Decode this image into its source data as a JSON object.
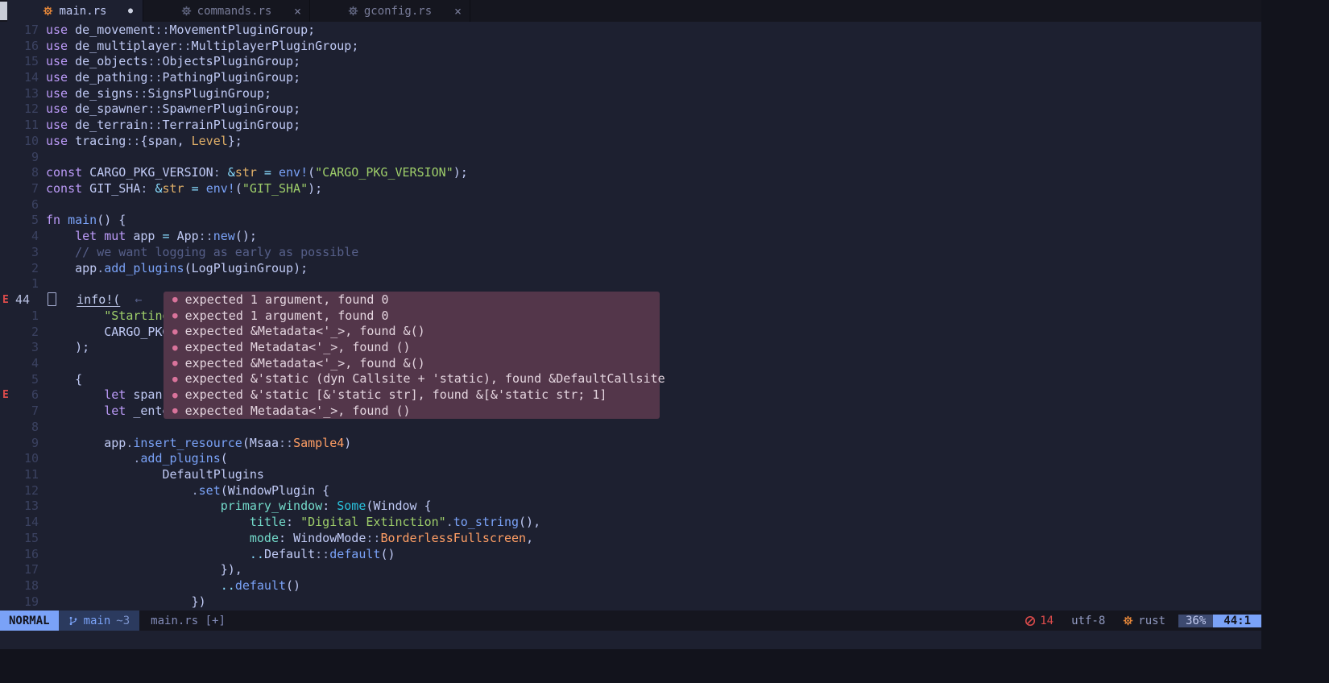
{
  "colors": {
    "accent": "#7aa2f7",
    "error": "#db4b4b",
    "editor_bg": "#1d2030",
    "tabline_bg": "#15161f",
    "popup_bg": "#53364a",
    "popup_bullet": "#d9739b",
    "rust_icon": "#e8883a",
    "keyword": "#bb9af7",
    "string": "#9ece6a"
  },
  "tabs": [
    {
      "label": "main.rs",
      "active": true,
      "modified": true,
      "close": false
    },
    {
      "label": "commands.rs",
      "active": false,
      "modified": false,
      "close": true
    },
    {
      "label": "gconfig.rs",
      "active": false,
      "modified": false,
      "close": true
    }
  ],
  "tab_close_glyph": "×",
  "tab_modified_glyph": "●",
  "editor": {
    "lines": [
      {
        "sign": "",
        "num": "17",
        "segs": [
          [
            "kw",
            "use"
          ],
          [
            "fg",
            " de_movement"
          ],
          [
            "pn",
            "::"
          ],
          [
            "ty",
            "MovementPluginGroup"
          ],
          [
            "fg",
            ";"
          ]
        ]
      },
      {
        "sign": "",
        "num": "16",
        "segs": [
          [
            "kw",
            "use"
          ],
          [
            "fg",
            " de_multiplayer"
          ],
          [
            "pn",
            "::"
          ],
          [
            "ty",
            "MultiplayerPluginGroup"
          ],
          [
            "fg",
            ";"
          ]
        ]
      },
      {
        "sign": "",
        "num": "15",
        "segs": [
          [
            "kw",
            "use"
          ],
          [
            "fg",
            " de_objects"
          ],
          [
            "pn",
            "::"
          ],
          [
            "ty",
            "ObjectsPluginGroup"
          ],
          [
            "fg",
            ";"
          ]
        ]
      },
      {
        "sign": "",
        "num": "14",
        "segs": [
          [
            "kw",
            "use"
          ],
          [
            "fg",
            " de_pathing"
          ],
          [
            "pn",
            "::"
          ],
          [
            "ty",
            "PathingPluginGroup"
          ],
          [
            "fg",
            ";"
          ]
        ]
      },
      {
        "sign": "",
        "num": "13",
        "segs": [
          [
            "kw",
            "use"
          ],
          [
            "fg",
            " de_signs"
          ],
          [
            "pn",
            "::"
          ],
          [
            "ty",
            "SignsPluginGroup"
          ],
          [
            "fg",
            ";"
          ]
        ]
      },
      {
        "sign": "",
        "num": "12",
        "segs": [
          [
            "kw",
            "use"
          ],
          [
            "fg",
            " de_spawner"
          ],
          [
            "pn",
            "::"
          ],
          [
            "ty",
            "SpawnerPluginGroup"
          ],
          [
            "fg",
            ";"
          ]
        ]
      },
      {
        "sign": "",
        "num": "11",
        "segs": [
          [
            "kw",
            "use"
          ],
          [
            "fg",
            " de_terrain"
          ],
          [
            "pn",
            "::"
          ],
          [
            "ty",
            "TerrainPluginGroup"
          ],
          [
            "fg",
            ";"
          ]
        ]
      },
      {
        "sign": "",
        "num": "10",
        "segs": [
          [
            "kw",
            "use"
          ],
          [
            "fg",
            " tracing"
          ],
          [
            "pn",
            "::"
          ],
          [
            "fg",
            "{"
          ],
          [
            "id",
            "span"
          ],
          [
            "fg",
            ", "
          ],
          [
            "yl",
            "Level"
          ],
          [
            "fg",
            "};"
          ]
        ]
      },
      {
        "sign": "",
        "num": "9",
        "segs": []
      },
      {
        "sign": "",
        "num": "8",
        "segs": [
          [
            "kw",
            "const"
          ],
          [
            "fg",
            " CARGO_PKG_VERSION"
          ],
          [
            "pn",
            ":"
          ],
          [
            "op",
            " &"
          ],
          [
            "yl",
            "str"
          ],
          [
            "op",
            " = "
          ],
          [
            "fn",
            "env!"
          ],
          [
            "fg",
            "("
          ],
          [
            "str",
            "\"CARGO_PKG_VERSION\""
          ],
          [
            "fg",
            ");"
          ]
        ]
      },
      {
        "sign": "",
        "num": "7",
        "segs": [
          [
            "kw",
            "const"
          ],
          [
            "fg",
            " GIT_SHA"
          ],
          [
            "pn",
            ":"
          ],
          [
            "op",
            " &"
          ],
          [
            "yl",
            "str"
          ],
          [
            "op",
            " = "
          ],
          [
            "fn",
            "env!"
          ],
          [
            "fg",
            "("
          ],
          [
            "str",
            "\"GIT_SHA\""
          ],
          [
            "fg",
            ");"
          ]
        ]
      },
      {
        "sign": "",
        "num": "6",
        "segs": []
      },
      {
        "sign": "",
        "num": "5",
        "segs": [
          [
            "kw",
            "fn"
          ],
          [
            "fn",
            " main"
          ],
          [
            "fg",
            "() {"
          ]
        ]
      },
      {
        "sign": "",
        "num": "4",
        "segs": [
          [
            "fg",
            "    "
          ],
          [
            "kw",
            "let mut"
          ],
          [
            "fg",
            " app"
          ],
          [
            "op",
            " = "
          ],
          [
            "ty",
            "App"
          ],
          [
            "pn",
            "::"
          ],
          [
            "fn",
            "new"
          ],
          [
            "fg",
            "();"
          ]
        ]
      },
      {
        "sign": "",
        "num": "3",
        "segs": [
          [
            "fg",
            "    "
          ],
          [
            "cm",
            "// we want logging as early as possible"
          ]
        ]
      },
      {
        "sign": "",
        "num": "2",
        "segs": [
          [
            "fg",
            "    "
          ],
          [
            "id",
            "app"
          ],
          [
            "pn",
            "."
          ],
          [
            "fn",
            "add_plugins"
          ],
          [
            "fg",
            "("
          ],
          [
            "ty",
            "LogPluginGroup"
          ],
          [
            "fg",
            ");"
          ]
        ]
      },
      {
        "sign": "",
        "num": "1",
        "segs": []
      },
      {
        "sign": "E",
        "num": "44",
        "cur": true,
        "cursor": true,
        "segs": [
          [
            "fg",
            "    "
          ],
          [
            "macerr",
            "info!("
          ],
          [
            "fg",
            "  "
          ],
          [
            "hint",
            "←"
          ]
        ]
      },
      {
        "sign": "",
        "num": "1",
        "segs": [
          [
            "fg",
            "        "
          ],
          [
            "str",
            "\"Starting"
          ]
        ]
      },
      {
        "sign": "",
        "num": "2",
        "segs": [
          [
            "fg",
            "        "
          ],
          [
            "fg",
            "CARGO_PKG"
          ]
        ]
      },
      {
        "sign": "",
        "num": "3",
        "segs": [
          [
            "fg",
            "    "
          ],
          [
            "fg",
            ");"
          ]
        ]
      },
      {
        "sign": "",
        "num": "4",
        "segs": []
      },
      {
        "sign": "",
        "num": "5",
        "segs": [
          [
            "fg",
            "    "
          ],
          [
            "fg",
            "{"
          ]
        ]
      },
      {
        "sign": "E",
        "num": "6",
        "segs": [
          [
            "fg",
            "        "
          ],
          [
            "kw",
            "let"
          ],
          [
            "fg",
            " span"
          ]
        ]
      },
      {
        "sign": "",
        "num": "7",
        "segs": [
          [
            "fg",
            "        "
          ],
          [
            "kw",
            "let"
          ],
          [
            "fg",
            " _ente"
          ]
        ]
      },
      {
        "sign": "",
        "num": "8",
        "segs": []
      },
      {
        "sign": "",
        "num": "9",
        "segs": [
          [
            "fg",
            "        "
          ],
          [
            "id",
            "app"
          ],
          [
            "pn",
            "."
          ],
          [
            "fn",
            "insert_resource"
          ],
          [
            "fg",
            "("
          ],
          [
            "ty",
            "Msaa"
          ],
          [
            "pn",
            "::"
          ],
          [
            "var",
            "Sample4"
          ],
          [
            "fg",
            ")"
          ]
        ]
      },
      {
        "sign": "",
        "num": "10",
        "segs": [
          [
            "fg",
            "            "
          ],
          [
            "pn",
            "."
          ],
          [
            "fn",
            "add_plugins"
          ],
          [
            "fg",
            "("
          ]
        ]
      },
      {
        "sign": "",
        "num": "11",
        "segs": [
          [
            "fg",
            "                "
          ],
          [
            "ty",
            "DefaultPlugins"
          ]
        ]
      },
      {
        "sign": "",
        "num": "12",
        "segs": [
          [
            "fg",
            "                    "
          ],
          [
            "pn",
            "."
          ],
          [
            "fn",
            "set"
          ],
          [
            "fg",
            "("
          ],
          [
            "ty",
            "WindowPlugin"
          ],
          [
            "fg",
            " {"
          ]
        ]
      },
      {
        "sign": "",
        "num": "13",
        "segs": [
          [
            "fg",
            "                        "
          ],
          [
            "fld",
            "primary_window"
          ],
          [
            "fg",
            ": "
          ],
          [
            "ctor",
            "Some"
          ],
          [
            "fg",
            "("
          ],
          [
            "ty",
            "Window"
          ],
          [
            "fg",
            " {"
          ]
        ]
      },
      {
        "sign": "",
        "num": "14",
        "segs": [
          [
            "fg",
            "                            "
          ],
          [
            "fld",
            "title"
          ],
          [
            "fg",
            ": "
          ],
          [
            "str",
            "\"Digital Extinction\""
          ],
          [
            "pn",
            "."
          ],
          [
            "fn",
            "to_string"
          ],
          [
            "fg",
            "(),"
          ]
        ]
      },
      {
        "sign": "",
        "num": "15",
        "segs": [
          [
            "fg",
            "                            "
          ],
          [
            "fld",
            "mode"
          ],
          [
            "fg",
            ": "
          ],
          [
            "ty",
            "WindowMode"
          ],
          [
            "pn",
            "::"
          ],
          [
            "var",
            "BorderlessFullscreen"
          ],
          [
            "fg",
            ","
          ]
        ]
      },
      {
        "sign": "",
        "num": "16",
        "segs": [
          [
            "fg",
            "                            "
          ],
          [
            "op",
            ".."
          ],
          [
            "ty",
            "Default"
          ],
          [
            "pn",
            "::"
          ],
          [
            "fn",
            "default"
          ],
          [
            "fg",
            "()"
          ]
        ]
      },
      {
        "sign": "",
        "num": "17",
        "segs": [
          [
            "fg",
            "                        "
          ],
          [
            "fg",
            "}),"
          ]
        ]
      },
      {
        "sign": "",
        "num": "18",
        "segs": [
          [
            "fg",
            "                        "
          ],
          [
            "op",
            ".."
          ],
          [
            "fn",
            "default"
          ],
          [
            "fg",
            "()"
          ]
        ]
      },
      {
        "sign": "",
        "num": "19",
        "segs": [
          [
            "fg",
            "                    "
          ],
          [
            "fg",
            "})"
          ]
        ]
      }
    ]
  },
  "popup": {
    "bullet": "●",
    "items": [
      "expected 1 argument, found 0",
      "expected 1 argument, found 0",
      "expected &Metadata<'_>, found &()",
      "expected Metadata<'_>, found ()",
      "expected &Metadata<'_>, found &()",
      "expected &'static (dyn Callsite + 'static), found &DefaultCallsite",
      "expected &'static [&'static str], found &[&'static str; 1]",
      "expected Metadata<'_>, found ()"
    ]
  },
  "statusline": {
    "mode": "NORMAL",
    "branch": "main",
    "diff": "~3",
    "filename": "main.rs [+]",
    "errors": "14",
    "encoding": "utf-8",
    "filetype": "rust",
    "progress": "36%",
    "location": "44:1"
  }
}
